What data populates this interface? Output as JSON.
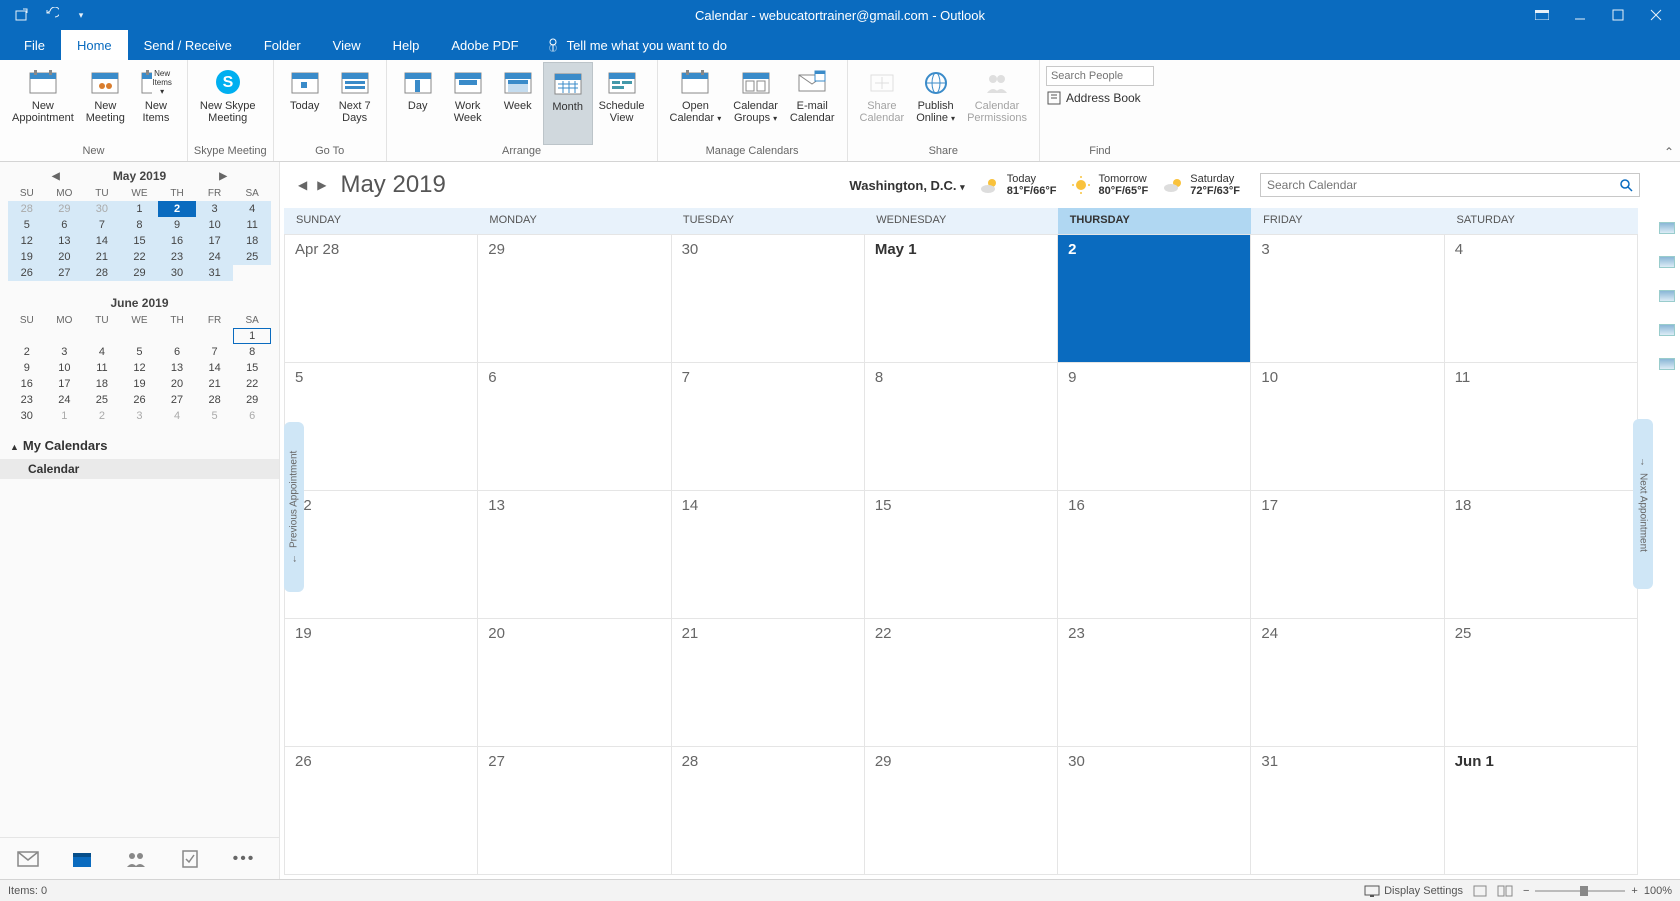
{
  "titlebar": {
    "title": "Calendar - webucatortrainer@gmail.com - Outlook"
  },
  "tabs": [
    "File",
    "Home",
    "Send / Receive",
    "Folder",
    "View",
    "Help",
    "Adobe PDF"
  ],
  "active_tab": "Home",
  "tellme": "Tell me what you want to do",
  "ribbon": {
    "new": {
      "label": "New",
      "items": [
        "New\nAppointment",
        "New\nMeeting",
        "New\nItems"
      ]
    },
    "skype": {
      "label": "Skype Meeting",
      "item": "New Skype\nMeeting"
    },
    "goto": {
      "label": "Go To",
      "items": [
        "Today",
        "Next 7\nDays"
      ]
    },
    "arrange": {
      "label": "Arrange",
      "items": [
        "Day",
        "Work\nWeek",
        "Week",
        "Month",
        "Schedule\nView"
      ]
    },
    "manage": {
      "label": "Manage Calendars",
      "items": [
        "Open\nCalendar",
        "Calendar\nGroups",
        "E-mail\nCalendar"
      ]
    },
    "share": {
      "label": "Share",
      "items": [
        "Share\nCalendar",
        "Publish\nOnline",
        "Calendar\nPermissions"
      ]
    },
    "find": {
      "label": "Find",
      "search_placeholder": "Search People",
      "addressbook": "Address Book"
    }
  },
  "minical1": {
    "title": "May 2019",
    "dow": [
      "SU",
      "MO",
      "TU",
      "WE",
      "TH",
      "FR",
      "SA"
    ],
    "rows": [
      [
        {
          "n": 28,
          "dim": 1,
          "m": 1
        },
        {
          "n": 29,
          "dim": 1,
          "m": 1
        },
        {
          "n": 30,
          "dim": 1,
          "m": 1
        },
        {
          "n": 1,
          "m": 1
        },
        {
          "n": 2,
          "today": 1,
          "m": 1
        },
        {
          "n": 3,
          "m": 1
        },
        {
          "n": 4,
          "m": 1
        }
      ],
      [
        {
          "n": 5,
          "m": 1
        },
        {
          "n": 6,
          "m": 1
        },
        {
          "n": 7,
          "m": 1
        },
        {
          "n": 8,
          "m": 1
        },
        {
          "n": 9,
          "m": 1
        },
        {
          "n": 10,
          "m": 1
        },
        {
          "n": 11,
          "m": 1
        }
      ],
      [
        {
          "n": 12,
          "m": 1
        },
        {
          "n": 13,
          "m": 1
        },
        {
          "n": 14,
          "m": 1
        },
        {
          "n": 15,
          "m": 1
        },
        {
          "n": 16,
          "m": 1
        },
        {
          "n": 17,
          "m": 1
        },
        {
          "n": 18,
          "m": 1
        }
      ],
      [
        {
          "n": 19,
          "m": 1
        },
        {
          "n": 20,
          "m": 1
        },
        {
          "n": 21,
          "m": 1
        },
        {
          "n": 22,
          "m": 1
        },
        {
          "n": 23,
          "m": 1
        },
        {
          "n": 24,
          "m": 1
        },
        {
          "n": 25,
          "m": 1
        }
      ],
      [
        {
          "n": 26,
          "m": 1
        },
        {
          "n": 27,
          "m": 1
        },
        {
          "n": 28,
          "m": 1
        },
        {
          "n": 29,
          "m": 1
        },
        {
          "n": 30,
          "m": 1
        },
        {
          "n": 31,
          "m": 1
        },
        {
          "n": ""
        }
      ]
    ]
  },
  "minical2": {
    "title": "June 2019",
    "dow": [
      "SU",
      "MO",
      "TU",
      "WE",
      "TH",
      "FR",
      "SA"
    ],
    "rows": [
      [
        {
          "n": ""
        },
        {
          "n": ""
        },
        {
          "n": ""
        },
        {
          "n": ""
        },
        {
          "n": ""
        },
        {
          "n": ""
        },
        {
          "n": 1,
          "boxed": 1
        }
      ],
      [
        {
          "n": 2
        },
        {
          "n": 3
        },
        {
          "n": 4
        },
        {
          "n": 5
        },
        {
          "n": 6
        },
        {
          "n": 7
        },
        {
          "n": 8
        }
      ],
      [
        {
          "n": 9
        },
        {
          "n": 10
        },
        {
          "n": 11
        },
        {
          "n": 12
        },
        {
          "n": 13
        },
        {
          "n": 14
        },
        {
          "n": 15
        }
      ],
      [
        {
          "n": 16
        },
        {
          "n": 17
        },
        {
          "n": 18
        },
        {
          "n": 19
        },
        {
          "n": 20
        },
        {
          "n": 21
        },
        {
          "n": 22
        }
      ],
      [
        {
          "n": 23
        },
        {
          "n": 24
        },
        {
          "n": 25
        },
        {
          "n": 26
        },
        {
          "n": 27
        },
        {
          "n": 28
        },
        {
          "n": 29
        }
      ],
      [
        {
          "n": 30
        },
        {
          "n": 1,
          "dim": 1
        },
        {
          "n": 2,
          "dim": 1
        },
        {
          "n": 3,
          "dim": 1
        },
        {
          "n": 4,
          "dim": 1
        },
        {
          "n": 5,
          "dim": 1
        },
        {
          "n": 6,
          "dim": 1
        }
      ]
    ]
  },
  "mycal_label": "My Calendars",
  "calendar_item": "Calendar",
  "main_title": "May 2019",
  "location": "Washington,  D.C.",
  "weather": [
    {
      "label": "Today",
      "temp": "81°F/66°F"
    },
    {
      "label": "Tomorrow",
      "temp": "80°F/65°F"
    },
    {
      "label": "Saturday",
      "temp": "72°F/63°F"
    }
  ],
  "search_cal_placeholder": "Search Calendar",
  "day_headers": [
    "SUNDAY",
    "MONDAY",
    "TUESDAY",
    "WEDNESDAY",
    "THURSDAY",
    "FRIDAY",
    "SATURDAY"
  ],
  "today_col": 4,
  "grid": [
    [
      {
        "t": "Apr 28"
      },
      {
        "t": "29"
      },
      {
        "t": "30"
      },
      {
        "t": "May 1",
        "bold": 1
      },
      {
        "t": "2",
        "today": 1
      },
      {
        "t": "3"
      },
      {
        "t": "4"
      }
    ],
    [
      {
        "t": "5"
      },
      {
        "t": "6"
      },
      {
        "t": "7"
      },
      {
        "t": "8"
      },
      {
        "t": "9"
      },
      {
        "t": "10"
      },
      {
        "t": "11"
      }
    ],
    [
      {
        "t": "12"
      },
      {
        "t": "13"
      },
      {
        "t": "14"
      },
      {
        "t": "15"
      },
      {
        "t": "16"
      },
      {
        "t": "17"
      },
      {
        "t": "18"
      }
    ],
    [
      {
        "t": "19"
      },
      {
        "t": "20"
      },
      {
        "t": "21"
      },
      {
        "t": "22"
      },
      {
        "t": "23"
      },
      {
        "t": "24"
      },
      {
        "t": "25"
      }
    ],
    [
      {
        "t": "26"
      },
      {
        "t": "27"
      },
      {
        "t": "28"
      },
      {
        "t": "29"
      },
      {
        "t": "30"
      },
      {
        "t": "31"
      },
      {
        "t": "Jun 1",
        "bold": 1
      }
    ]
  ],
  "prev_appt": "Previous Appointment",
  "next_appt": "Next Appointment",
  "status_items": "Items: 0",
  "display_settings": "Display Settings",
  "zoom": "100%"
}
